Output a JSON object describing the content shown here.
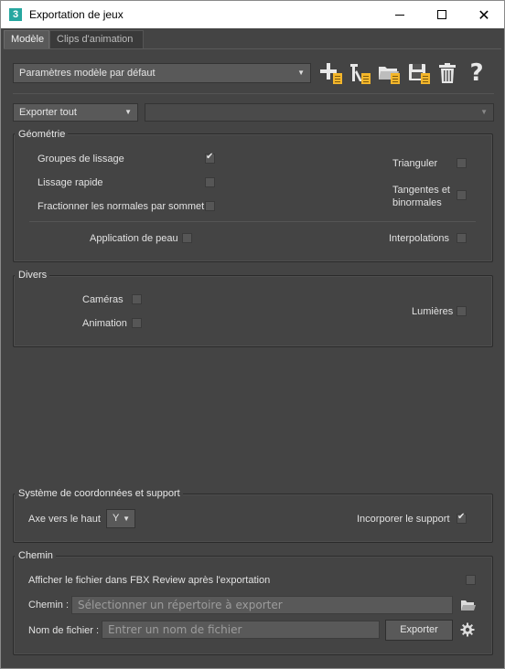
{
  "window": {
    "title": "Exportation de jeux",
    "app_icon": "3",
    "controls": {
      "minimize": "minimize-icon",
      "maximize": "maximize-icon",
      "close": "✕"
    }
  },
  "tabs": [
    {
      "label": "Modèle",
      "active": true
    },
    {
      "label": "Clips d'animation",
      "active": false
    }
  ],
  "preset": {
    "value": "Paramètres modèle par défaut"
  },
  "toolbar": {
    "icons": [
      "add-preset-icon",
      "edit-preset-icon",
      "open-preset-icon",
      "save-preset-icon",
      "delete-icon",
      "help-icon"
    ],
    "help_glyph": "?"
  },
  "export_scope": {
    "value": "Exporter tout",
    "secondary_value": ""
  },
  "geometry": {
    "title": "Géométrie",
    "smoothing_groups": {
      "label": "Groupes de lissage",
      "checked": true
    },
    "fast_smoothing": {
      "label": "Lissage rapide",
      "checked": false
    },
    "split_normals": {
      "label": "Fractionner les normales par sommet",
      "checked": false
    },
    "triangulate": {
      "label": "Trianguler",
      "checked": false
    },
    "tangents_line1": "Tangentes et",
    "tangents_line2": "binormales",
    "tangents_checked": false,
    "skinning": {
      "label": "Application de peau",
      "checked": false
    },
    "interpolations": {
      "label": "Interpolations",
      "checked": false
    }
  },
  "misc": {
    "title": "Divers",
    "cameras": {
      "label": "Caméras",
      "checked": false
    },
    "animation": {
      "label": "Animation",
      "checked": false
    },
    "lights": {
      "label": "Lumières",
      "checked": false
    }
  },
  "coords": {
    "title": "Système de coordonnées et support",
    "up_axis_label": "Axe vers le haut",
    "up_axis_value": "Y",
    "embed_media": {
      "label": "Incorporer le support",
      "checked": true
    }
  },
  "path": {
    "title": "Chemin",
    "fbx_review": {
      "label": "Afficher le fichier dans FBX Review après l'exportation",
      "checked": false
    },
    "folder_label": "Chemin :",
    "folder_placeholder": "Sélectionner un répertoire à exporter",
    "filename_label": "Nom de fichier :",
    "filename_placeholder": "Entrer un nom de fichier",
    "export_button": "Exporter"
  },
  "colors": {
    "accent_yellow": "#f4b62b",
    "app_teal": "#27a7a0",
    "panel_bg": "#444444"
  }
}
